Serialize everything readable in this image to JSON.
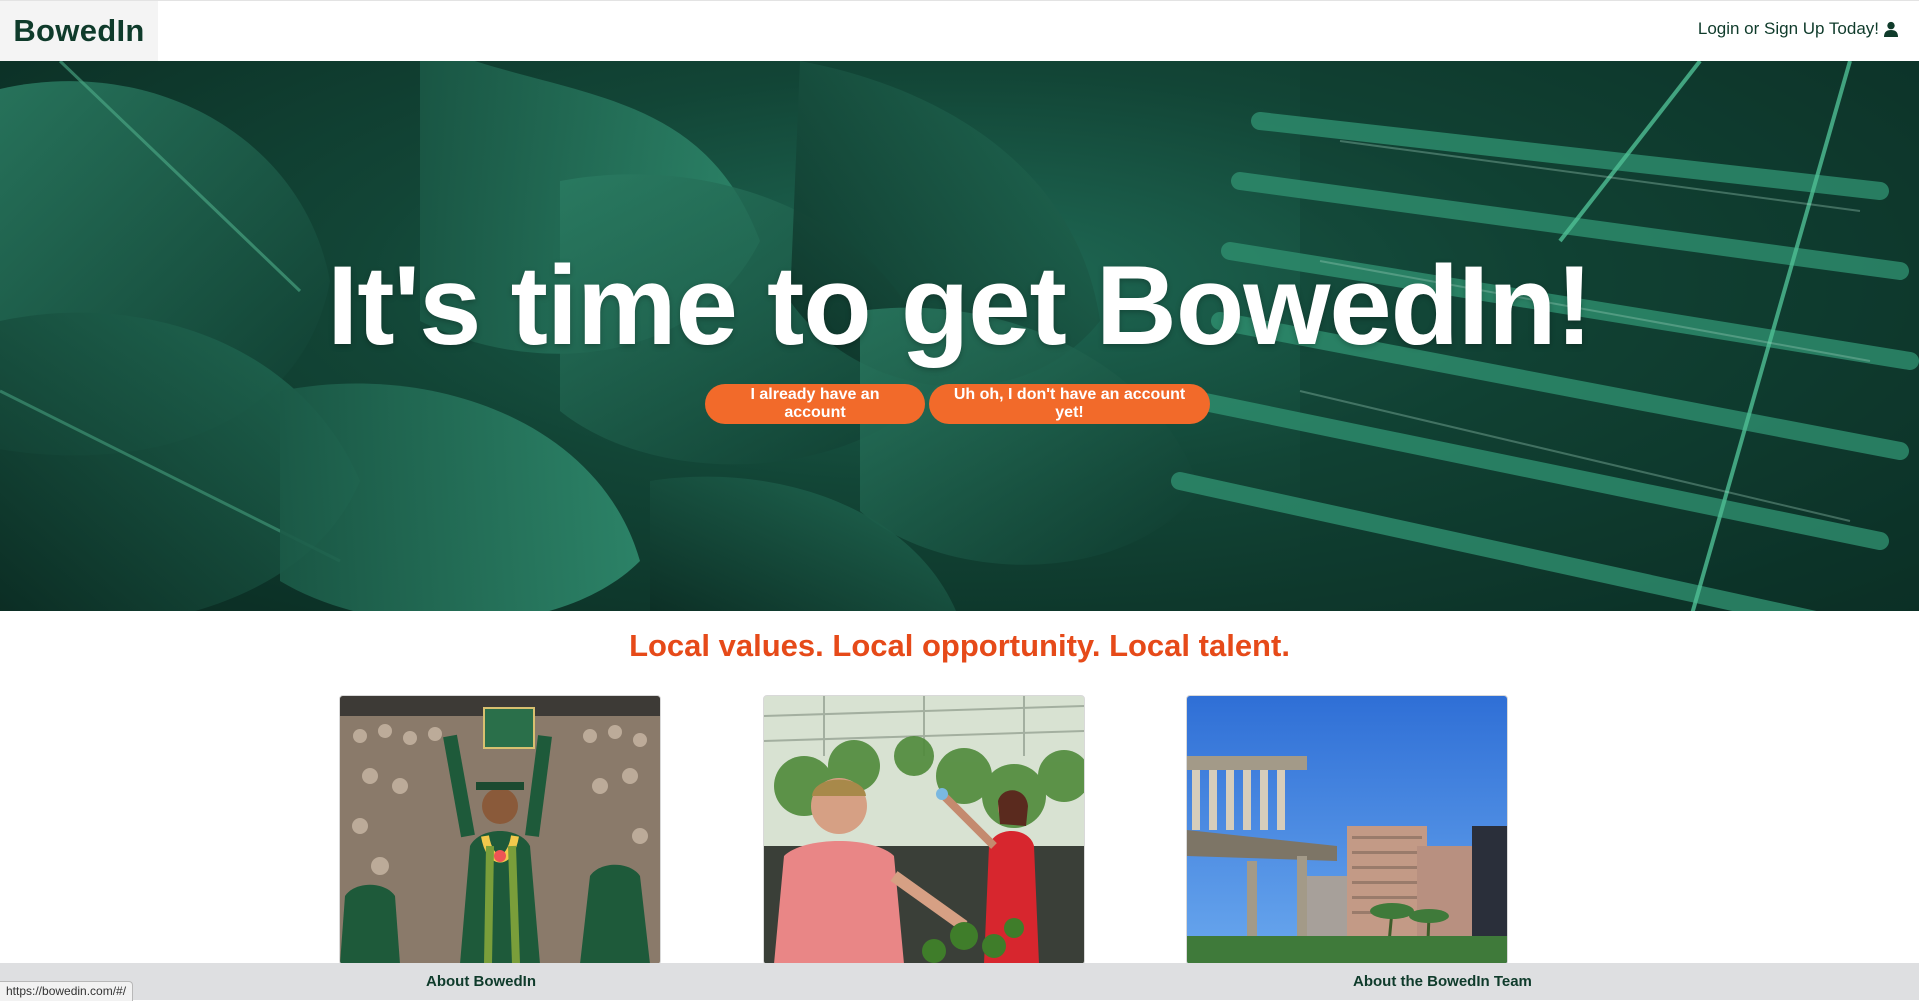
{
  "navbar": {
    "brand": "BowedIn",
    "login_label": "Login or Sign Up Today!",
    "login_icon": "user-icon"
  },
  "hero": {
    "title": "It's time to get BowedIn!",
    "buttons": {
      "login_label": "I already have an account",
      "signup_label": "Uh oh, I don't have an account yet!"
    }
  },
  "tagline": "Local values. Local opportunity. Local talent.",
  "cards": [
    {
      "image": "graduate-photo"
    },
    {
      "image": "greenhouse-photo"
    },
    {
      "image": "city-buildings-photo"
    }
  ],
  "footer": {
    "about_label": "About BowedIn",
    "team_label": "About the BowedIn Team"
  },
  "status_bar": {
    "url": "https://bowedin.com/#/"
  },
  "colors": {
    "brand_green": "#0f3b2b",
    "accent_orange": "#f26a2a",
    "tagline_red": "#e64a19",
    "footer_gray": "#dedfe1"
  }
}
